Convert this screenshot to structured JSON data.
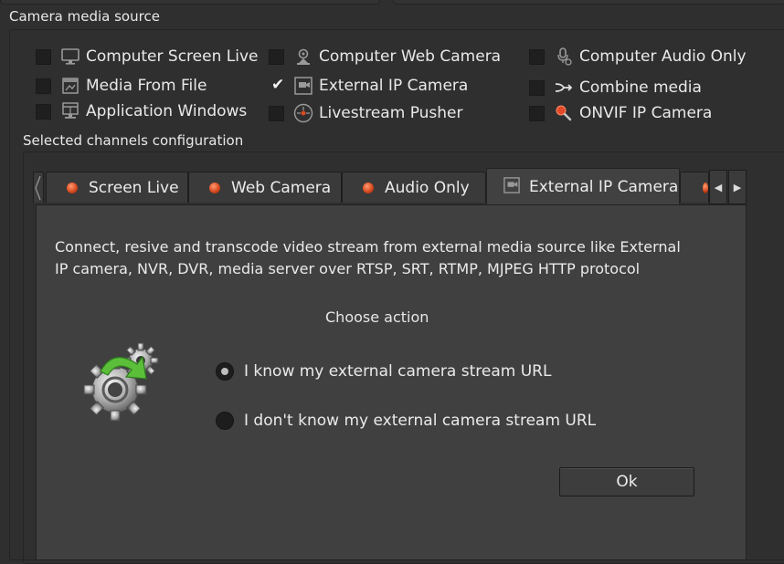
{
  "group_title": "Camera media source",
  "sources": [
    {
      "label": "Computer Screen Live",
      "checked": false,
      "icon": "monitor-icon"
    },
    {
      "label": "Computer Web Camera",
      "checked": false,
      "icon": "webcam-icon"
    },
    {
      "label": "Computer Audio Only",
      "checked": false,
      "icon": "microphone-icon"
    },
    {
      "label": "Media From File",
      "checked": false,
      "icon": "media-file-icon"
    },
    {
      "label": "External IP Camera",
      "checked": true,
      "icon": "ip-camera-icon"
    },
    {
      "label": "Combine media",
      "checked": false,
      "icon": "combine-icon"
    },
    {
      "label": "Application Windows",
      "checked": false,
      "icon": "app-windows-icon"
    },
    {
      "label": "Livestream Pusher",
      "checked": false,
      "icon": "livestream-icon"
    },
    {
      "label": "ONVIF IP Camera",
      "checked": false,
      "icon": "onvif-search-icon"
    }
  ],
  "channels_title": "Selected channels configuration",
  "tabs": [
    {
      "label": "Screen Live",
      "active": false
    },
    {
      "label": "Web Camera",
      "active": false
    },
    {
      "label": "Audio Only",
      "active": false
    },
    {
      "label": "External IP Camera",
      "active": true
    }
  ],
  "panel": {
    "description_line1": "Connect, resive and transcode video stream from external media source like External",
    "description_line2": "IP camera,  NVR, DVR, media server over RTSP, SRT, RTMP, MJPEG HTTP protocol",
    "choose_action": "Choose action",
    "options": [
      {
        "label": "I know my external camera stream URL",
        "selected": true
      },
      {
        "label": "I don't know my external camera stream URL",
        "selected": false
      }
    ],
    "ok_label": "Ok"
  },
  "colors": {
    "background": "#2f2f2f",
    "panel": "#404040",
    "tab_dot": "#d94a20",
    "accent_green": "#5bbf3a"
  }
}
